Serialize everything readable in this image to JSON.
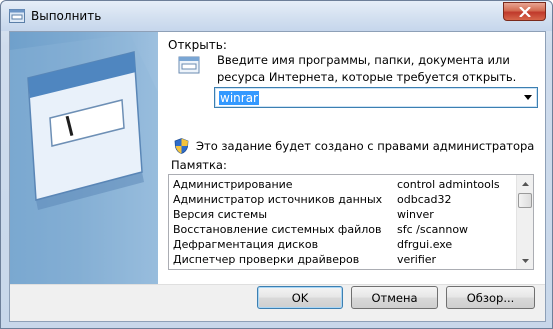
{
  "window": {
    "title": "Выполнить"
  },
  "dialog": {
    "open_label": "Открыть:",
    "description": "Введите имя программы, папки, документа или ресурса Интернета, которые требуется открыть.",
    "input_value": "winrar",
    "admin_note": "Это задание будет создано с правами администратора",
    "hint_label": "Памятка:"
  },
  "list": {
    "rows": [
      {
        "name": "Администрирование",
        "command": "control admintools"
      },
      {
        "name": "Администратор источников данных",
        "command": "odbcad32"
      },
      {
        "name": "Версия системы",
        "command": "winver"
      },
      {
        "name": "Восстановление системных файлов",
        "command": "sfc /scannow"
      },
      {
        "name": "Дефрагментация дисков",
        "command": "dfrgui.exe"
      },
      {
        "name": "Диспетчер проверки драйверов",
        "command": "verifier"
      }
    ]
  },
  "buttons": {
    "ok": "OK",
    "cancel": "Отмена",
    "browse": "Обзор..."
  },
  "icons": {
    "title": "run-icon",
    "close": "close-icon",
    "program": "program-window-icon",
    "shield": "uac-shield-icon",
    "dropdown": "chevron-down-icon"
  },
  "colors": {
    "selection": "#3399ff",
    "close_button": "#c0392b",
    "banner": "#7eaad1"
  }
}
